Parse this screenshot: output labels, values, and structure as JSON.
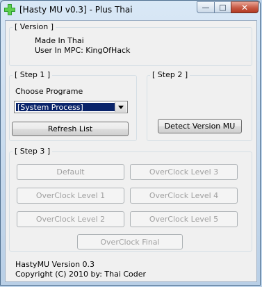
{
  "window": {
    "title": "[Hasty MU v0.3] - Plus Thai",
    "minimize_icon": "minimize-icon",
    "maximize_icon": "maximize-icon",
    "close_icon": "close-icon"
  },
  "version_group": {
    "label": "[ Version ]",
    "made_in": "Made In Thai",
    "user": "User In MPC: KingOfHack"
  },
  "step1": {
    "label": "[ Step 1 ]",
    "choose_label": "Choose Programe",
    "selected_process": "[System Process]",
    "refresh_button": "Refresh List"
  },
  "step2": {
    "label": "[ Step 2 ]",
    "detect_button": "Detect Version MU"
  },
  "step3": {
    "label": "[ Step 3 ]",
    "buttons": [
      "Default",
      "OverClock Level 3",
      "OverClock Level 1",
      "OverClock Level 4",
      "OverClock Level 2",
      "OverClock Level 5",
      "OverClock Final"
    ]
  },
  "footer": {
    "version": "HastyMU Version 0.3",
    "copyright": "Copyright (C) 2010 by: Thai Coder"
  },
  "colors": {
    "selection": "#0a246a",
    "client_bg": "#f0f0f0"
  }
}
